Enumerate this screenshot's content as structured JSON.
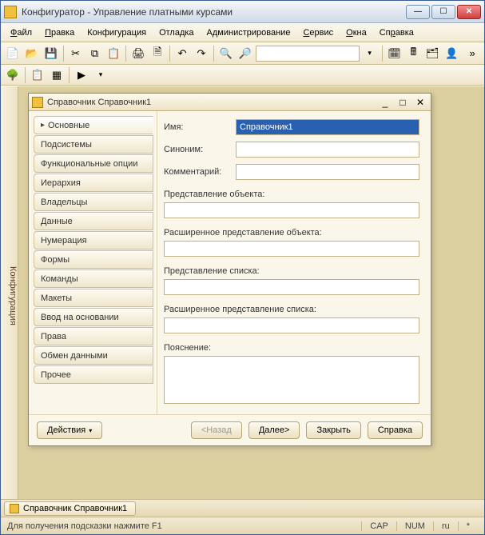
{
  "window": {
    "title": "Конфигуратор - Управление платными курсами"
  },
  "menu": {
    "file": "Файл",
    "edit": "Правка",
    "config": "Конфигурация",
    "debug": "Отладка",
    "admin": "Администрирование",
    "service": "Сервис",
    "windows": "Окна",
    "help": "Справка"
  },
  "side_tab": "Конфигурация",
  "inner": {
    "title": "Справочник Справочник1",
    "tabs": [
      "Основные",
      "Подсистемы",
      "Функциональные опции",
      "Иерархия",
      "Владельцы",
      "Данные",
      "Нумерация",
      "Формы",
      "Команды",
      "Макеты",
      "Ввод на основании",
      "Права",
      "Обмен данными",
      "Прочее"
    ],
    "form": {
      "name_label": "Имя:",
      "name_value": "Справочник1",
      "synonym_label": "Синоним:",
      "synonym_value": "",
      "comment_label": "Комментарий:",
      "comment_value": "",
      "obj_repr_label": "Представление объекта:",
      "obj_repr_value": "",
      "ext_obj_repr_label": "Расширенное представление объекта:",
      "ext_obj_repr_value": "",
      "list_repr_label": "Представление списка:",
      "list_repr_value": "",
      "ext_list_repr_label": "Расширенное представление списка:",
      "ext_list_repr_value": "",
      "explanation_label": "Пояснение:",
      "explanation_value": ""
    },
    "buttons": {
      "actions": "Действия",
      "back": "<Назад",
      "next": "Далее>",
      "close": "Закрыть",
      "help": "Справка"
    }
  },
  "taskbar_tab": "Справочник Справочник1",
  "status": {
    "hint": "Для получения подсказки нажмите F1",
    "cap": "CAP",
    "num": "NUM",
    "lang": "ru",
    "star": "*"
  }
}
